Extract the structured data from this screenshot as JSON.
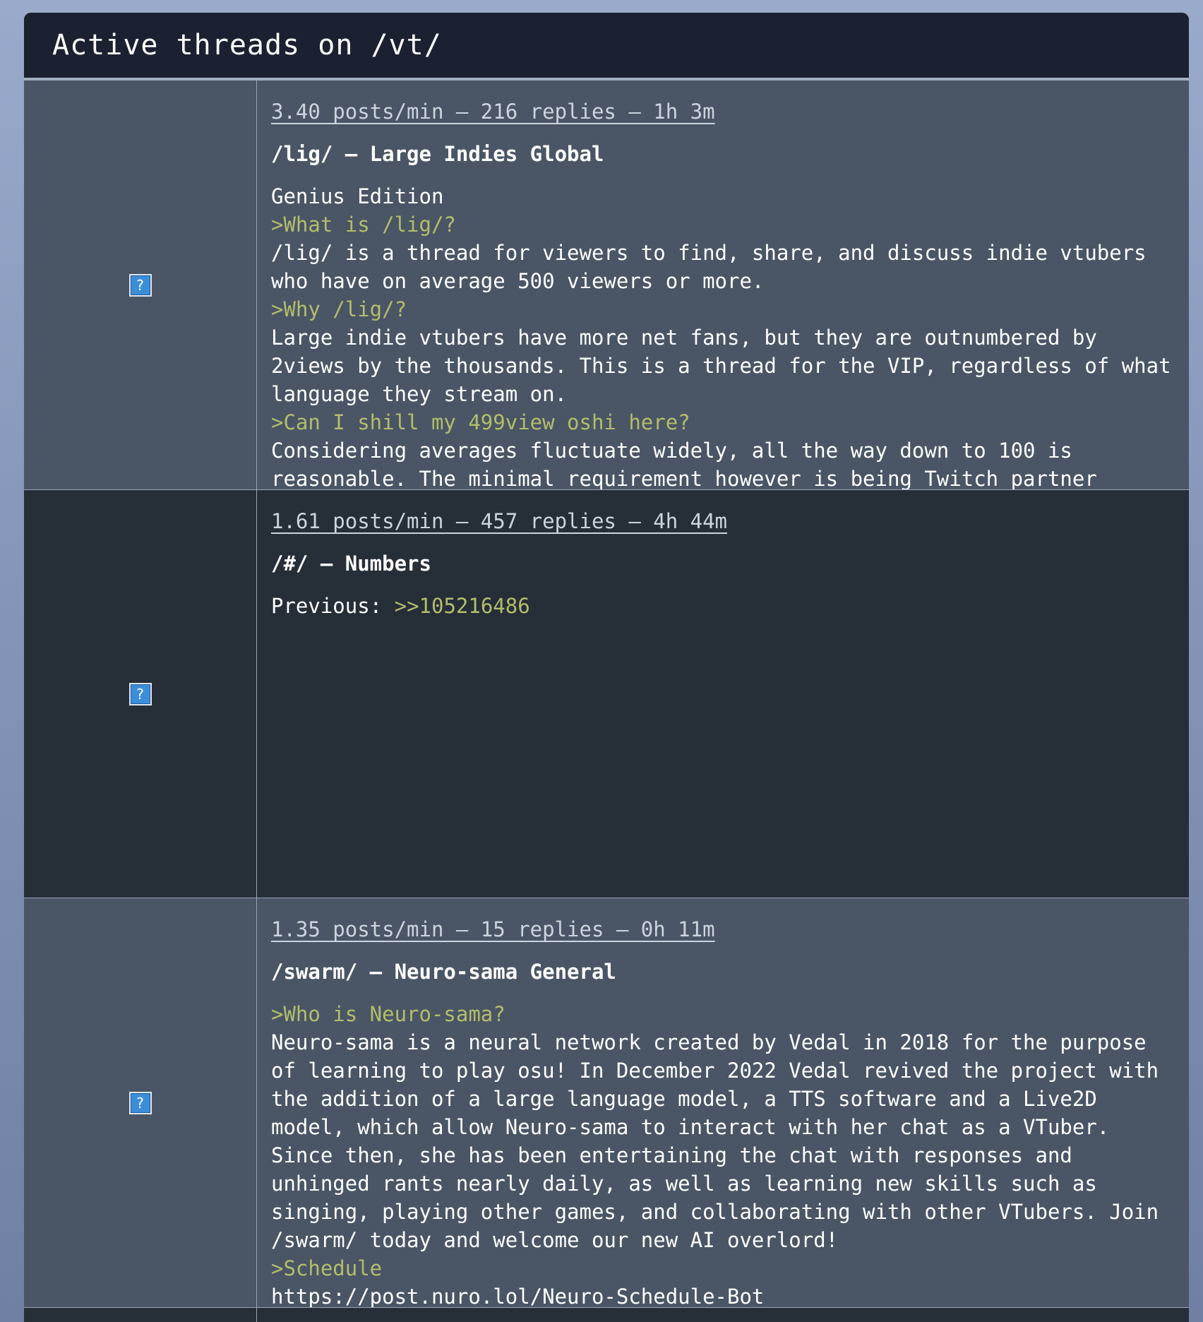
{
  "header": {
    "title": "Active threads on /vt/"
  },
  "threads": [
    {
      "stats": "3.40 posts/min – 216 replies – 1h 3m",
      "title": "/lig/ – Large Indies Global",
      "lines": [
        {
          "type": "text",
          "text": "Genius Edition"
        },
        {
          "type": "green",
          "text": ">What is /lig/?"
        },
        {
          "type": "text",
          "text": "/lig/ is a thread for viewers to find, share, and discuss indie vtubers who have on average 500 viewers or more."
        },
        {
          "type": "green",
          "text": ">Why /lig/?"
        },
        {
          "type": "text",
          "text": "Large indie vtubers have more net fans, but they are outnumbered by 2views by the thousands. This is a thread for the VIP, regardless of what language they stream on."
        },
        {
          "type": "green",
          "text": ">Can I shill my 499view oshi here?"
        },
        {
          "type": "text",
          "text": "Considering averages fluctuate widely, all the way down to 100 is reasonable. The minimal requirement however is being Twitch partner"
        }
      ]
    },
    {
      "stats": "1.61 posts/min – 457 replies – 4h 44m",
      "title": "/#/ – Numbers",
      "previous_label": "Previous: ",
      "previous_link": ">>105216486"
    },
    {
      "stats": "1.35 posts/min – 15 replies – 0h 11m",
      "title": "/swarm/ – Neuro-sama General",
      "lines": [
        {
          "type": "green",
          "text": ">Who is Neuro-sama?"
        },
        {
          "type": "text",
          "text": "Neuro-sama is a neural network created by Vedal in 2018 for the purpose of learning to play osu! In December 2022 Vedal revived the project with the addition of a large language model, a TTS software and a Live2D model, which allow Neuro-sama to interact with her chat as a VTuber. Since then, she has been entertaining the chat with responses and unhinged rants nearly daily, as well as learning new skills such as singing, playing other games, and collaborating with other VTubers. Join /swarm/ today and welcome our new AI overlord!"
        },
        {
          "type": "green",
          "text": ">Schedule"
        },
        {
          "type": "text",
          "text": "https://post.nuro.lol/Neuro-Schedule-Bot"
        }
      ]
    }
  ],
  "thumbnail_icon": "broken-image-icon",
  "thumbnail_glyph": "?"
}
